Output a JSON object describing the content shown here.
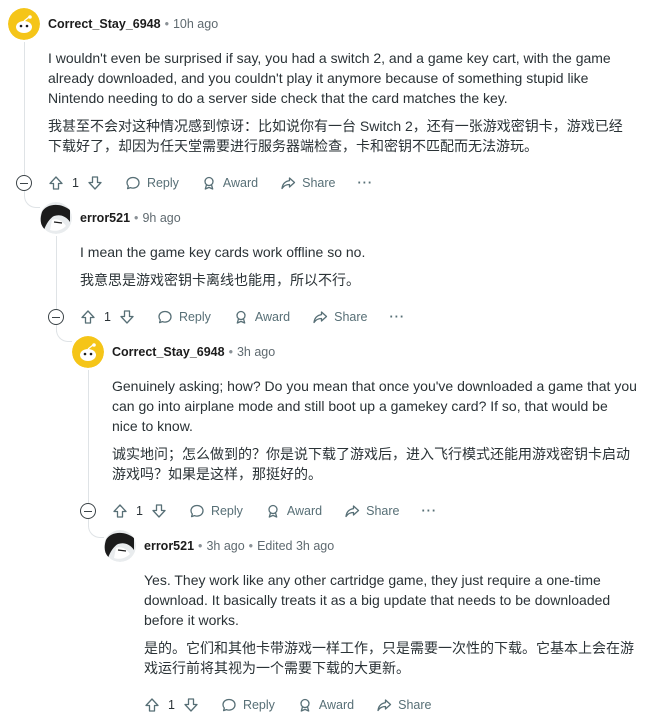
{
  "comments": [
    {
      "username": "Correct_Stay_6948",
      "time": "10h ago",
      "text_en": "I wouldn't even be surprised if say, you had a switch 2, and a game key cart, with the game already downloaded, and you couldn't play it anymore because of something stupid like Nintendo needing to do a server side check that the card matches the key.",
      "text_zh": "我甚至不会对这种情况感到惊讶：比如说你有一台 Switch 2，还有一张游戏密钥卡，游戏已经下载好了，却因为任天堂需要进行服务器端检查，卡和密钥不匹配而无法游玩。",
      "score": "1",
      "avatar_icon": "snoo-avatar"
    },
    {
      "username": "error521",
      "time": "9h ago",
      "text_en": "I mean the game key cards work offline so no.",
      "text_zh": "我意思是游戏密钥卡离线也能用，所以不行。",
      "score": "1",
      "avatar_icon": "dark-anime-avatar"
    },
    {
      "username": "Correct_Stay_6948",
      "time": "3h ago",
      "text_en": "Genuinely asking; how? Do you mean that once you've downloaded a game that you can go into airplane mode and still boot up a gamekey card? If so, that would be nice to know.",
      "text_zh": "诚实地问；怎么做到的？你是说下载了游戏后，进入飞行模式还能用游戏密钥卡启动游戏吗？如果是这样，那挺好的。",
      "score": "1",
      "avatar_icon": "snoo-avatar"
    },
    {
      "username": "error521",
      "time": "3h ago",
      "edited": "Edited 3h ago",
      "text_en": "Yes. They work like any other cartridge game, they just require a one-time download. It basically treats it as a big update that needs to be downloaded before it works.",
      "text_zh": "是的。它们和其他卡带游戏一样工作，只是需要一次性的下载。它基本上会在游戏运行前将其视为一个需要下载的大更新。",
      "score": "1",
      "avatar_icon": "dark-anime-avatar"
    }
  ],
  "actions": {
    "reply": "Reply",
    "award": "Award",
    "share": "Share",
    "more": "···"
  },
  "colors": {
    "accent_time": "#5f6a70",
    "thread_line": "#dfe3e6",
    "snoo_yellow": "#f5c518",
    "text": "#2a3236"
  }
}
